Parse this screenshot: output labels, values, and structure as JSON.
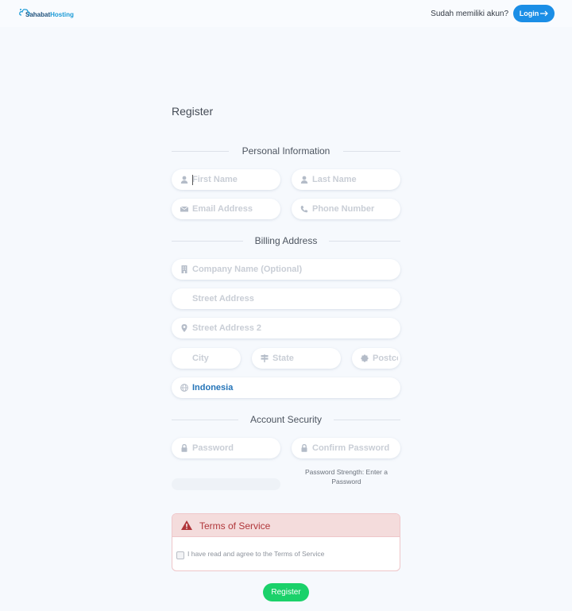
{
  "header": {
    "brand_part1": "Sahabat",
    "brand_part2": "Hosting",
    "have_account": "Sudah memiliki akun?",
    "login_label": "Login"
  },
  "page_title": "Register",
  "sections": {
    "personal": "Personal Information",
    "billing": "Billing Address",
    "security": "Account Security"
  },
  "fields": {
    "first_name": "First Name",
    "last_name": "Last Name",
    "email": "Email Address",
    "phone": "Phone Number",
    "company": "Company Name (Optional)",
    "street": "Street Address",
    "street2": "Street Address 2",
    "city": "City",
    "state": "State",
    "postcode": "Postcode",
    "country_value": "Indonesia",
    "password": "Password",
    "confirm_password": "Confirm Password"
  },
  "password_strength": "Password Strength: Enter a Password",
  "tos": {
    "title": "Terms of Service",
    "agree_text": "I have read and agree to the Terms of Service"
  },
  "register_label": "Register",
  "colors": {
    "accent": "#1b8ee6",
    "register": "#1bd16a",
    "tos_danger": "#b0363a",
    "background": "#f6f9fd"
  }
}
